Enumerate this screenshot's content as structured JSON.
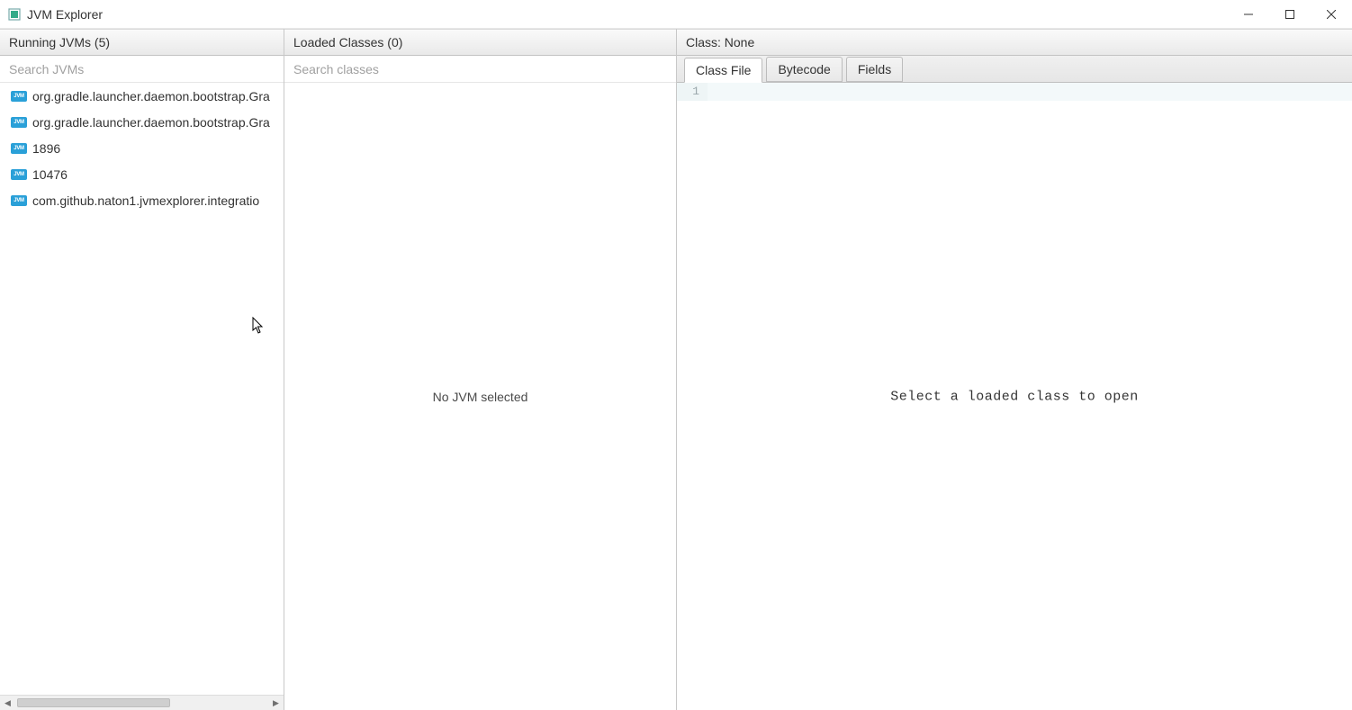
{
  "window": {
    "title": "JVM Explorer"
  },
  "panels": {
    "jvms": {
      "header": "Running JVMs (5)",
      "search_placeholder": "Search JVMs",
      "items": [
        "org.gradle.launcher.daemon.bootstrap.Gra",
        "org.gradle.launcher.daemon.bootstrap.Gra",
        "1896",
        "10476",
        "com.github.naton1.jvmexplorer.integratio"
      ]
    },
    "classes": {
      "header": "Loaded Classes (0)",
      "search_placeholder": "Search classes",
      "empty_text": "No JVM selected"
    },
    "detail": {
      "header": "Class: None",
      "tabs": [
        {
          "label": "Class File",
          "active": true
        },
        {
          "label": "Bytecode",
          "active": false
        },
        {
          "label": "Fields",
          "active": false
        }
      ],
      "line_number": "1",
      "placeholder": "Select a loaded class to open"
    }
  }
}
